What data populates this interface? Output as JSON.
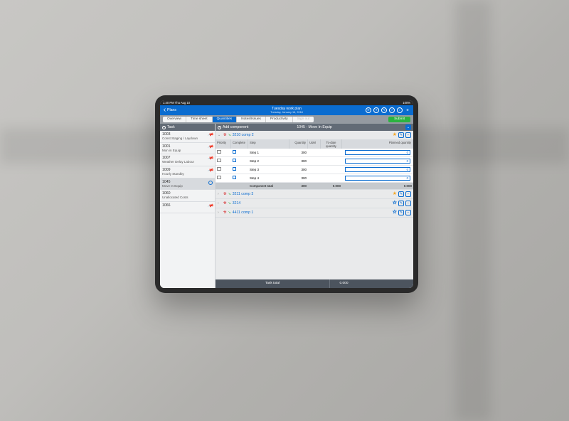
{
  "statusbar": {
    "left": "1:40 PM  Thu Aug 10",
    "right": "100%"
  },
  "header": {
    "back": "Plans",
    "title": "Tuesday work plan",
    "subtitle": "Tuesday, January 16, 2018",
    "icons": [
      "sync",
      "compass",
      "edit",
      "help",
      "info",
      "settings"
    ]
  },
  "tabs": [
    {
      "label": "Overview"
    },
    {
      "label": "Time sheet"
    },
    {
      "label": "Quantities",
      "active": true
    },
    {
      "label": "Notes/Issues"
    },
    {
      "label": "Productivity"
    },
    {
      "label": "Sign out",
      "disabled": true
    }
  ],
  "submit": "Submit",
  "sidebar": {
    "header": "Task",
    "tasks": [
      {
        "code": "1003",
        "name": "Const Staging / Laydown",
        "pin": "red"
      },
      {
        "code": "1001",
        "name": "Mon in Equip",
        "pin": "green"
      },
      {
        "code": "1007",
        "name": "Weather Delay Labour",
        "pin": "green"
      },
      {
        "code": "1009",
        "name": "Hourly Standby",
        "pin": "green"
      },
      {
        "code": "1045",
        "name": "Move In Equip",
        "selected": true
      },
      {
        "code": "1060",
        "name": "Unallocated Costs"
      },
      {
        "code": "1066",
        "name": "",
        "pin": "green"
      }
    ]
  },
  "main": {
    "addComponent": "Add component",
    "title": "1045 - Move In Equip",
    "columns": {
      "priority": "Priority",
      "complete": "Complete",
      "step": "Step",
      "quantity": "Quantity",
      "uom": "UoM",
      "todate": "To-date quantity",
      "planned": "Planned quantity"
    },
    "components": [
      {
        "num": "3210 comp 2",
        "expanded": true,
        "starred": true,
        "steps": [
          {
            "name": "Step 1",
            "qty": "300",
            "plan": "0"
          },
          {
            "name": "Step 2",
            "qty": "300",
            "plan": "0"
          },
          {
            "name": "Step 3",
            "qty": "300",
            "plan": "0"
          },
          {
            "name": "Step 4",
            "qty": "300",
            "plan": "0"
          }
        ],
        "total": {
          "label": "Component total",
          "qty": "300",
          "todate": "0.000",
          "plan": "0.000"
        }
      },
      {
        "num": "3211 comp 3",
        "starred": true
      },
      {
        "num": "3214"
      },
      {
        "num": "4411 comp 1"
      }
    ],
    "footer": {
      "label": "Task total",
      "val": "0.000"
    }
  }
}
